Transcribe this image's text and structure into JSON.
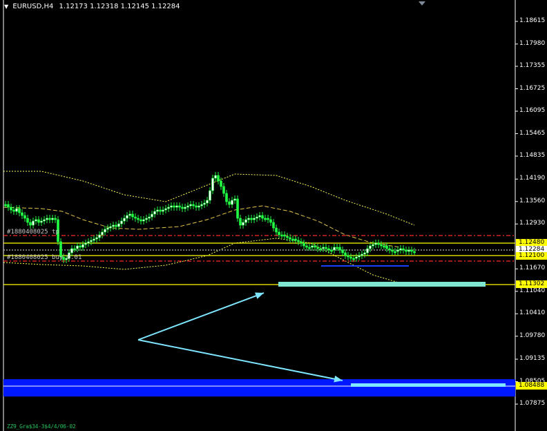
{
  "header": {
    "symbol": "EURUSD,H4",
    "quote": "1.12173 1.12318 1.12145 1.12284"
  },
  "order_labels": {
    "tp": "#1880408025 tp",
    "buy": "#1880408025 buy 0.01"
  },
  "footer": {
    "text": "ZZ9_Gra$34-3$4/4/06-02"
  },
  "price_axis": {
    "ticks": [
      "1.18615",
      "1.17980",
      "1.17355",
      "1.16725",
      "1.16095",
      "1.15465",
      "1.14835",
      "1.14190",
      "1.13560",
      "1.12930",
      "1.11670",
      "1.11040",
      "1.10410",
      "1.09780",
      "1.09135",
      "1.08505",
      "1.07875"
    ],
    "tags": [
      {
        "name": "price-tag-upper-level",
        "value": "1.12480",
        "bg": "#ffff00",
        "fg": "#000000"
      },
      {
        "name": "price-tag-current-price",
        "value": "1.12284",
        "bg": "#ffffff",
        "fg": "#000000"
      },
      {
        "name": "price-tag-lower-level",
        "value": "1.12100",
        "bg": "#ffff00",
        "fg": "#000000"
      },
      {
        "name": "price-tag-target-level",
        "value": "1.11302",
        "bg": "#ffff00",
        "fg": "#000000"
      },
      {
        "name": "price-tag-blue-level",
        "value": "1.08488",
        "bg": "#ffff00",
        "fg": "#000000"
      }
    ],
    "y_range": [
      1.075,
      1.1925
    ]
  },
  "colors": {
    "background": "#000000",
    "candles": "#22ff44",
    "level_lines": "#ffff00",
    "order_lines": "#ff2a2a",
    "bands": "#ffff55",
    "blue_zone": "#0018ff",
    "arrows": "#7fe6ff",
    "target_bar": "#7fe6d2"
  },
  "icons": {
    "header_arrow": "dropdown-triangle-icon",
    "corner": "shift-marker-icon"
  }
}
